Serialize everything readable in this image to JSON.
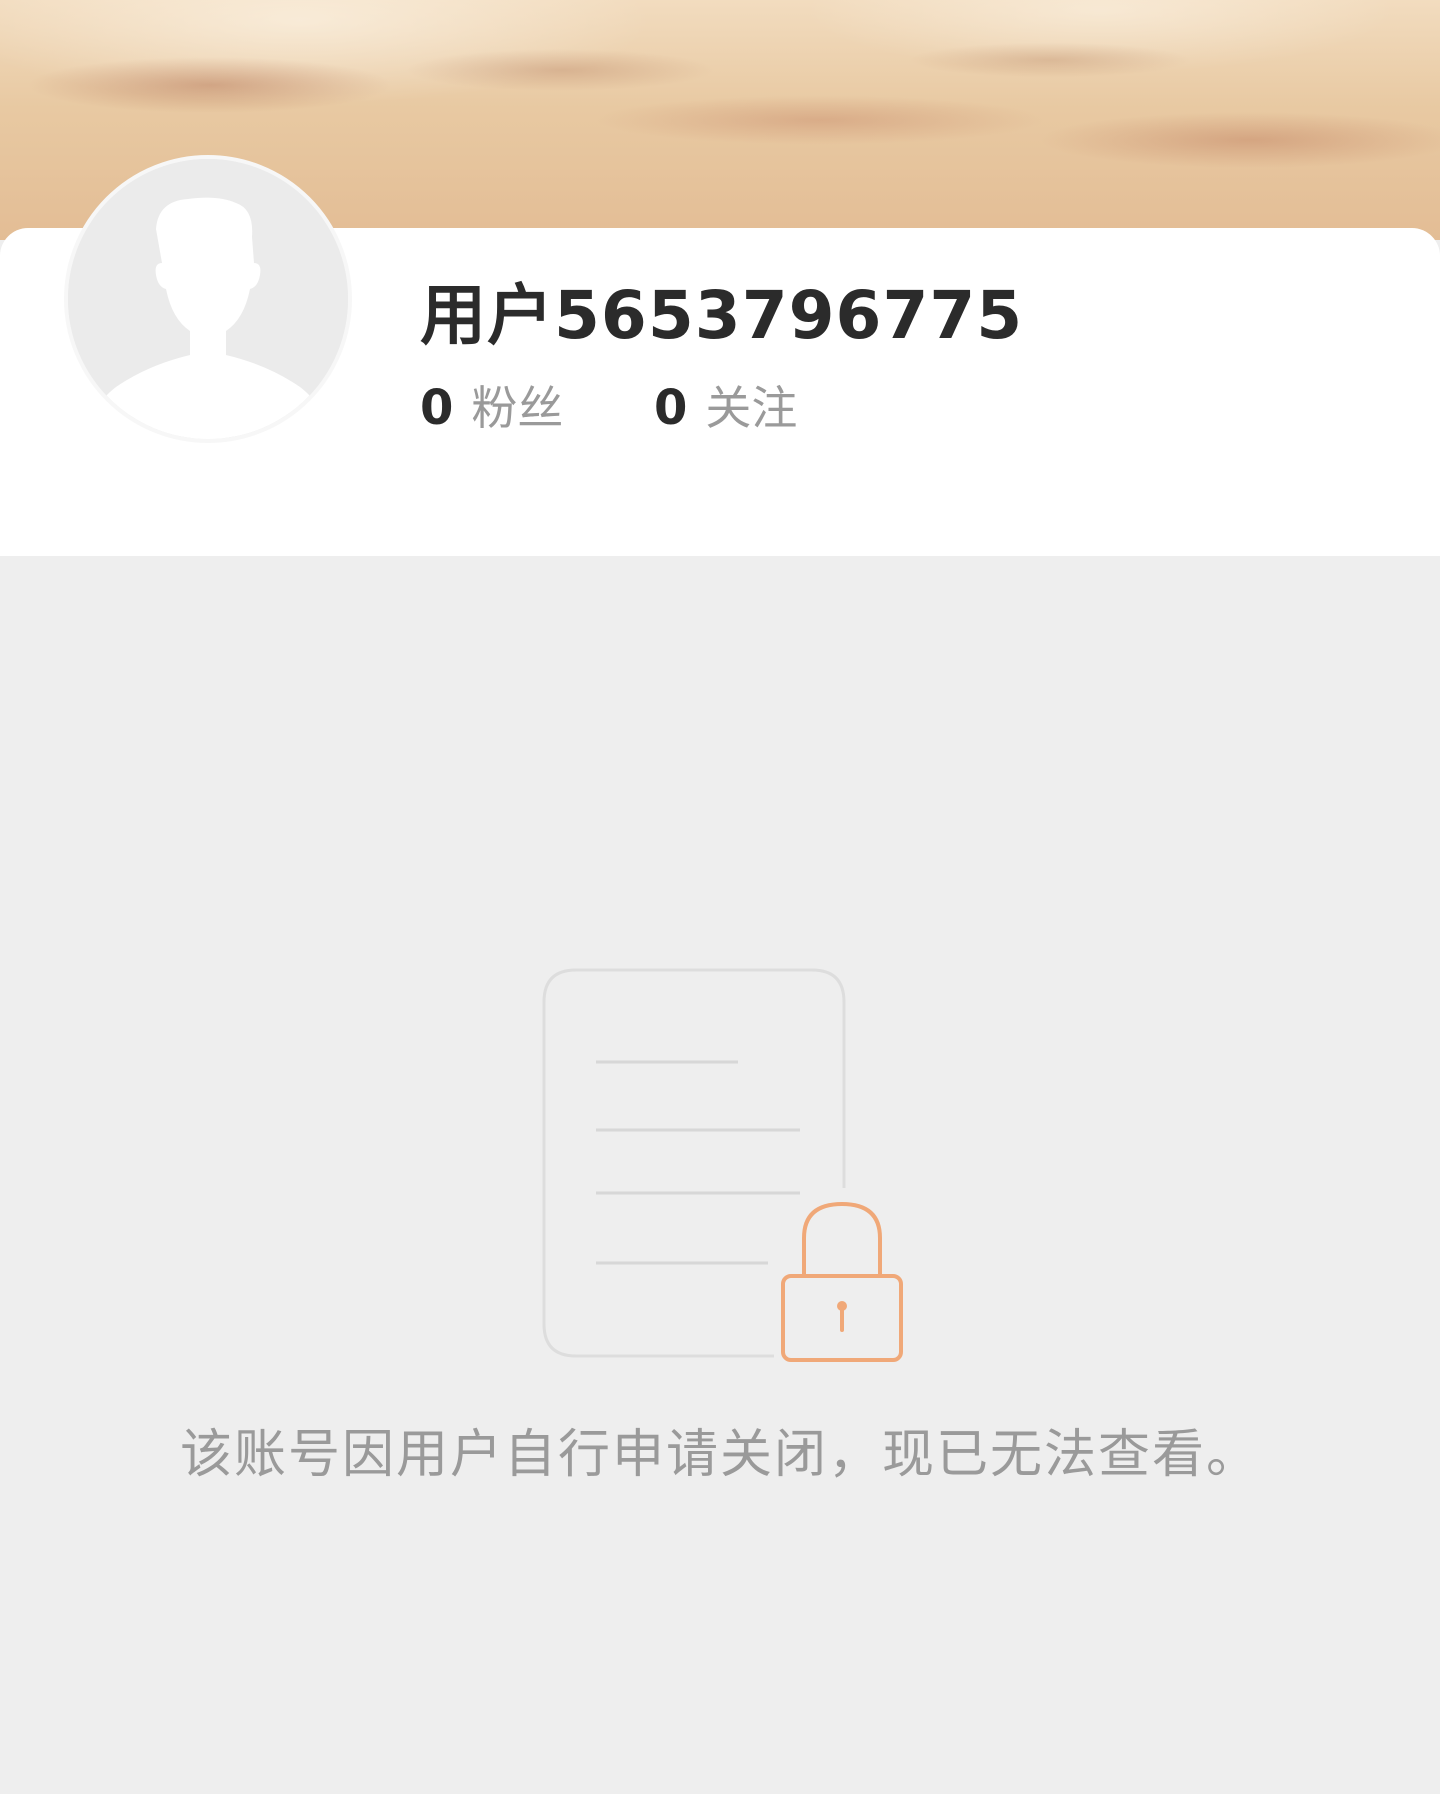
{
  "profile": {
    "username": "用户5653796775",
    "fans_count": "0",
    "fans_label": "粉丝",
    "following_count": "0",
    "following_label": "关注"
  },
  "notice": {
    "message": "该账号因用户自行申请关闭，现已无法查看。",
    "icon": "locked-document-icon"
  },
  "colors": {
    "page_background": "#eeeeee",
    "card_background": "#ffffff",
    "lock_accent": "#f0a878",
    "text_primary": "#2b2b2b",
    "text_secondary": "#9a9a9a"
  }
}
